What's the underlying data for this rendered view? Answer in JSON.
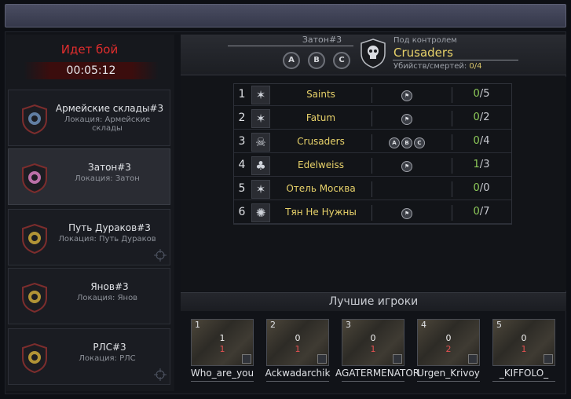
{
  "battle": {
    "status": "Идет бой",
    "timer": "00:05:12"
  },
  "locations": [
    {
      "name": "Армейские склады#3",
      "sub": "Локация: Армейские склады",
      "active": false,
      "color": "#6d8fb8"
    },
    {
      "name": "Затон#3",
      "sub": "Локация: Затон",
      "active": true,
      "color": "#d77fbf"
    },
    {
      "name": "Путь Дураков#3",
      "sub": "Локация: Путь Дураков",
      "active": false,
      "color": "#cda93a"
    },
    {
      "name": "Янов#3",
      "sub": "Локация: Янов",
      "active": false,
      "color": "#cda93a"
    },
    {
      "name": "РЛС#3",
      "sub": "Локация: РЛС",
      "active": false,
      "color": "#cda93a"
    }
  ],
  "header": {
    "zone": "Затон#3",
    "points": [
      "A",
      "B",
      "C"
    ],
    "control_label": "Под контролем",
    "control_name": "Crusaders",
    "score_label": "Убийств/смертей:",
    "score_value": "0/4"
  },
  "clans": [
    {
      "rank": "1",
      "name": "Saints",
      "points": [
        "flag"
      ],
      "kills": "0",
      "deaths": "5",
      "icon": "star-icon"
    },
    {
      "rank": "2",
      "name": "Fatum",
      "points": [
        "flag"
      ],
      "kills": "0",
      "deaths": "2",
      "icon": "star-icon"
    },
    {
      "rank": "3",
      "name": "Crusaders",
      "points": [
        "A",
        "B",
        "C"
      ],
      "kills": "0",
      "deaths": "4",
      "icon": "skull-icon"
    },
    {
      "rank": "4",
      "name": "Edelweiss",
      "points": [
        "flag"
      ],
      "kills": "1",
      "deaths": "3",
      "icon": "clover-icon"
    },
    {
      "rank": "5",
      "name": "Отель Москва",
      "points": [],
      "kills": "0",
      "deaths": "0",
      "icon": "star-icon"
    },
    {
      "rank": "6",
      "name": "Тян Не Нужны",
      "points": [
        "flag"
      ],
      "kills": "0",
      "deaths": "7",
      "icon": "octopus-icon"
    }
  ],
  "best_players": {
    "title": "Лучшие игроки",
    "players": [
      {
        "rank": "1",
        "name": "Who_are_you",
        "kills": "1",
        "deaths": "1"
      },
      {
        "rank": "2",
        "name": "Ackwadarchik",
        "kills": "0",
        "deaths": "1"
      },
      {
        "rank": "3",
        "name": "AGATERMENATOR",
        "kills": "0",
        "deaths": "1"
      },
      {
        "rank": "4",
        "name": "Urgen_Krivoy",
        "kills": "0",
        "deaths": "2"
      },
      {
        "rank": "5",
        "name": "_KIFFOLO_",
        "kills": "0",
        "deaths": "1"
      }
    ]
  }
}
